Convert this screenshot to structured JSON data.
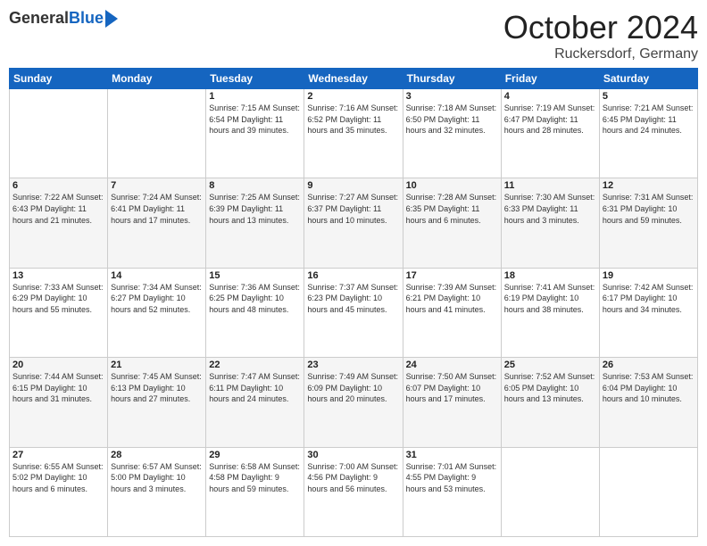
{
  "logo": {
    "general": "General",
    "blue": "Blue"
  },
  "title": {
    "month": "October 2024",
    "location": "Ruckersdorf, Germany"
  },
  "headers": [
    "Sunday",
    "Monday",
    "Tuesday",
    "Wednesday",
    "Thursday",
    "Friday",
    "Saturday"
  ],
  "weeks": [
    [
      {
        "day": "",
        "info": ""
      },
      {
        "day": "",
        "info": ""
      },
      {
        "day": "1",
        "info": "Sunrise: 7:15 AM\nSunset: 6:54 PM\nDaylight: 11 hours\nand 39 minutes."
      },
      {
        "day": "2",
        "info": "Sunrise: 7:16 AM\nSunset: 6:52 PM\nDaylight: 11 hours\nand 35 minutes."
      },
      {
        "day": "3",
        "info": "Sunrise: 7:18 AM\nSunset: 6:50 PM\nDaylight: 11 hours\nand 32 minutes."
      },
      {
        "day": "4",
        "info": "Sunrise: 7:19 AM\nSunset: 6:47 PM\nDaylight: 11 hours\nand 28 minutes."
      },
      {
        "day": "5",
        "info": "Sunrise: 7:21 AM\nSunset: 6:45 PM\nDaylight: 11 hours\nand 24 minutes."
      }
    ],
    [
      {
        "day": "6",
        "info": "Sunrise: 7:22 AM\nSunset: 6:43 PM\nDaylight: 11 hours\nand 21 minutes."
      },
      {
        "day": "7",
        "info": "Sunrise: 7:24 AM\nSunset: 6:41 PM\nDaylight: 11 hours\nand 17 minutes."
      },
      {
        "day": "8",
        "info": "Sunrise: 7:25 AM\nSunset: 6:39 PM\nDaylight: 11 hours\nand 13 minutes."
      },
      {
        "day": "9",
        "info": "Sunrise: 7:27 AM\nSunset: 6:37 PM\nDaylight: 11 hours\nand 10 minutes."
      },
      {
        "day": "10",
        "info": "Sunrise: 7:28 AM\nSunset: 6:35 PM\nDaylight: 11 hours\nand 6 minutes."
      },
      {
        "day": "11",
        "info": "Sunrise: 7:30 AM\nSunset: 6:33 PM\nDaylight: 11 hours\nand 3 minutes."
      },
      {
        "day": "12",
        "info": "Sunrise: 7:31 AM\nSunset: 6:31 PM\nDaylight: 10 hours\nand 59 minutes."
      }
    ],
    [
      {
        "day": "13",
        "info": "Sunrise: 7:33 AM\nSunset: 6:29 PM\nDaylight: 10 hours\nand 55 minutes."
      },
      {
        "day": "14",
        "info": "Sunrise: 7:34 AM\nSunset: 6:27 PM\nDaylight: 10 hours\nand 52 minutes."
      },
      {
        "day": "15",
        "info": "Sunrise: 7:36 AM\nSunset: 6:25 PM\nDaylight: 10 hours\nand 48 minutes."
      },
      {
        "day": "16",
        "info": "Sunrise: 7:37 AM\nSunset: 6:23 PM\nDaylight: 10 hours\nand 45 minutes."
      },
      {
        "day": "17",
        "info": "Sunrise: 7:39 AM\nSunset: 6:21 PM\nDaylight: 10 hours\nand 41 minutes."
      },
      {
        "day": "18",
        "info": "Sunrise: 7:41 AM\nSunset: 6:19 PM\nDaylight: 10 hours\nand 38 minutes."
      },
      {
        "day": "19",
        "info": "Sunrise: 7:42 AM\nSunset: 6:17 PM\nDaylight: 10 hours\nand 34 minutes."
      }
    ],
    [
      {
        "day": "20",
        "info": "Sunrise: 7:44 AM\nSunset: 6:15 PM\nDaylight: 10 hours\nand 31 minutes."
      },
      {
        "day": "21",
        "info": "Sunrise: 7:45 AM\nSunset: 6:13 PM\nDaylight: 10 hours\nand 27 minutes."
      },
      {
        "day": "22",
        "info": "Sunrise: 7:47 AM\nSunset: 6:11 PM\nDaylight: 10 hours\nand 24 minutes."
      },
      {
        "day": "23",
        "info": "Sunrise: 7:49 AM\nSunset: 6:09 PM\nDaylight: 10 hours\nand 20 minutes."
      },
      {
        "day": "24",
        "info": "Sunrise: 7:50 AM\nSunset: 6:07 PM\nDaylight: 10 hours\nand 17 minutes."
      },
      {
        "day": "25",
        "info": "Sunrise: 7:52 AM\nSunset: 6:05 PM\nDaylight: 10 hours\nand 13 minutes."
      },
      {
        "day": "26",
        "info": "Sunrise: 7:53 AM\nSunset: 6:04 PM\nDaylight: 10 hours\nand 10 minutes."
      }
    ],
    [
      {
        "day": "27",
        "info": "Sunrise: 6:55 AM\nSunset: 5:02 PM\nDaylight: 10 hours\nand 6 minutes."
      },
      {
        "day": "28",
        "info": "Sunrise: 6:57 AM\nSunset: 5:00 PM\nDaylight: 10 hours\nand 3 minutes."
      },
      {
        "day": "29",
        "info": "Sunrise: 6:58 AM\nSunset: 4:58 PM\nDaylight: 9 hours\nand 59 minutes."
      },
      {
        "day": "30",
        "info": "Sunrise: 7:00 AM\nSunset: 4:56 PM\nDaylight: 9 hours\nand 56 minutes."
      },
      {
        "day": "31",
        "info": "Sunrise: 7:01 AM\nSunset: 4:55 PM\nDaylight: 9 hours\nand 53 minutes."
      },
      {
        "day": "",
        "info": ""
      },
      {
        "day": "",
        "info": ""
      }
    ]
  ]
}
